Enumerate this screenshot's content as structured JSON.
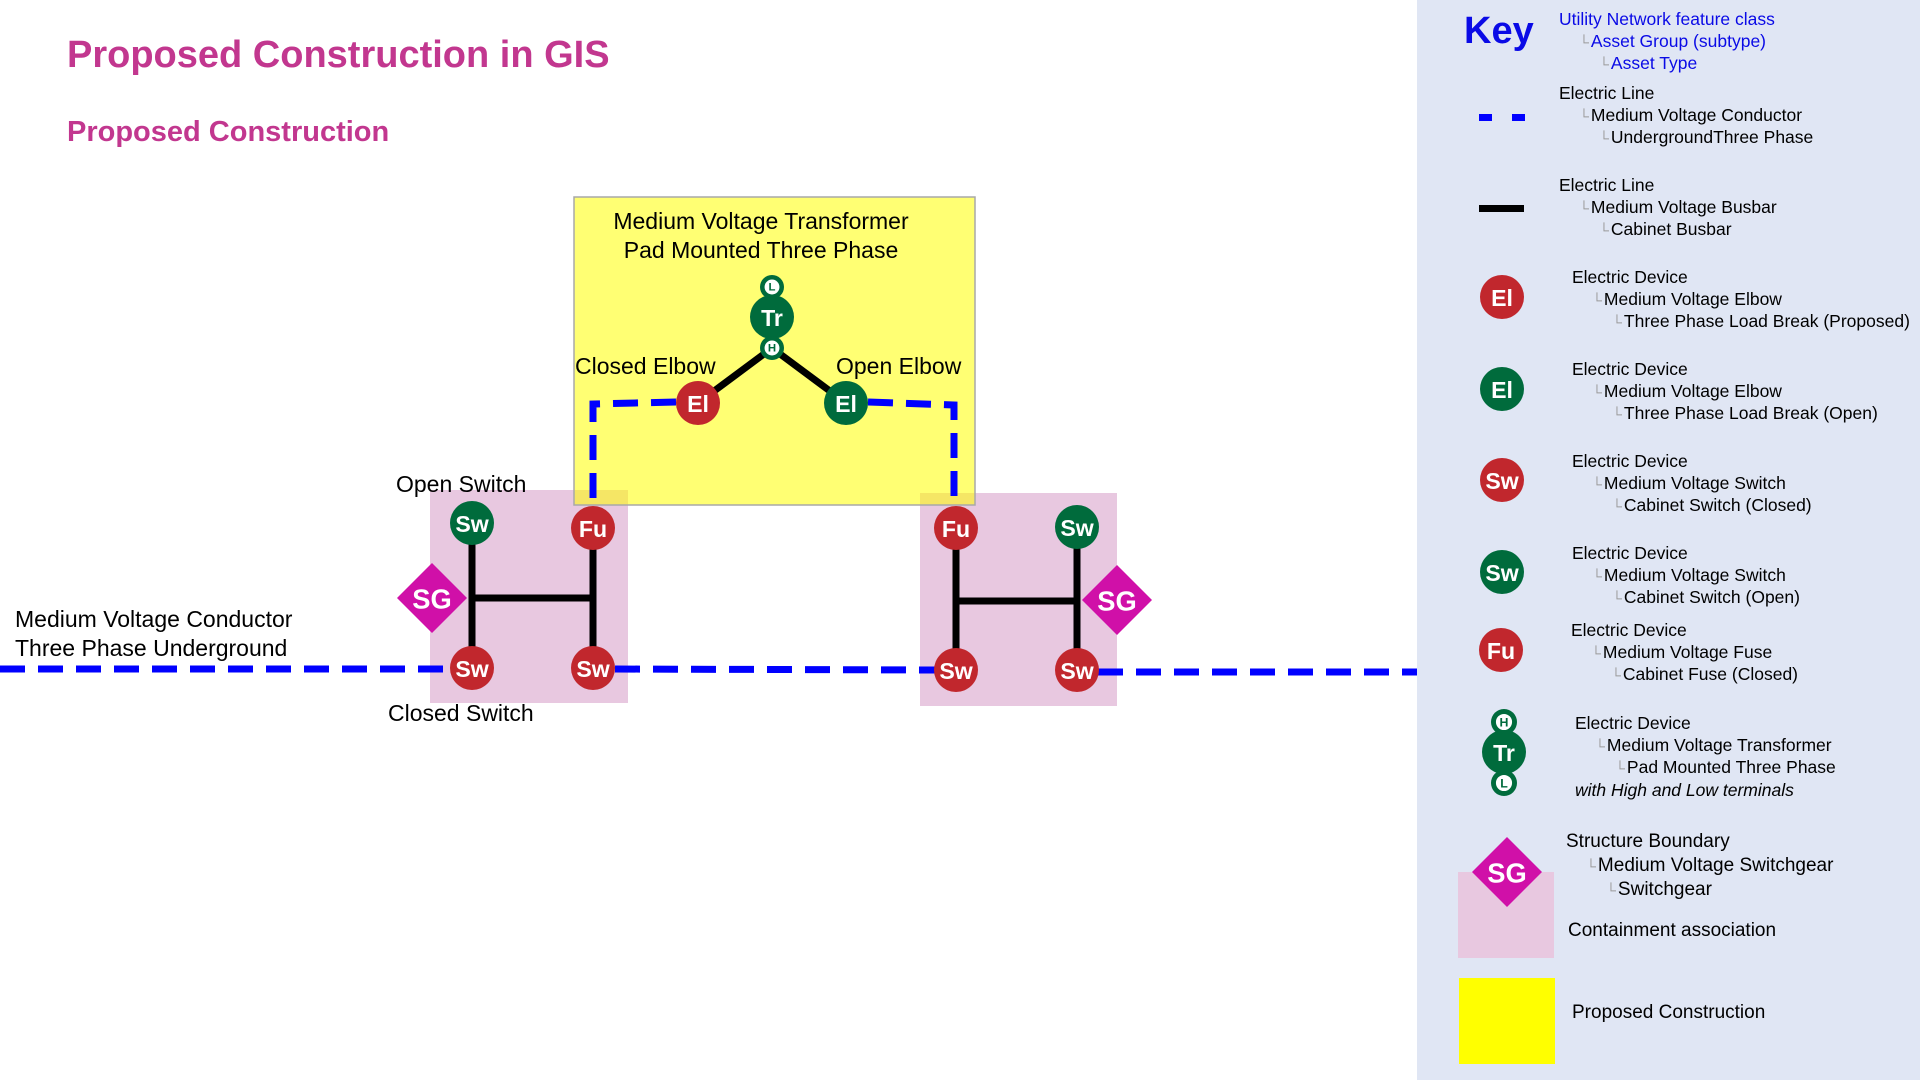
{
  "header": {
    "title": "Proposed Construction in GIS",
    "subtitle": "Proposed Construction"
  },
  "colors": {
    "title": "#c2378f",
    "conductor_blue": "#0000ff",
    "busbar_black": "#000000",
    "device_red": "#c1272d",
    "device_green": "#006b3c",
    "switchgear_magenta": "#d010a8",
    "containment_pink": "#e8c8e0",
    "proposed_yellow": "#ffff00",
    "key_background": "#e0e6f4",
    "key_heading_blue": "#0a0ae6"
  },
  "diagram": {
    "transformer_label_line1": "Medium Voltage Transformer",
    "transformer_label_line2": "Pad Mounted Three Phase",
    "closed_elbow_label": "Closed Elbow",
    "open_elbow_label": "Open Elbow",
    "open_switch_label": "Open Switch",
    "closed_switch_label": "Closed Switch",
    "conductor_label_line1": "Medium Voltage Conductor",
    "conductor_label_line2": "Three Phase Underground",
    "transformer": {
      "code": "Tr",
      "status": "green",
      "high_terminal": "H",
      "low_terminal": "L"
    },
    "elbows": [
      {
        "code": "El",
        "status": "red",
        "name": "closed-elbow"
      },
      {
        "code": "El",
        "status": "green",
        "name": "open-elbow"
      }
    ],
    "left_switchgear": {
      "code": "SG",
      "devices": [
        {
          "code": "Sw",
          "status": "green",
          "name": "open-switch"
        },
        {
          "code": "Fu",
          "status": "red",
          "name": "fuse"
        },
        {
          "code": "Sw",
          "status": "red",
          "name": "closed-switch-left"
        },
        {
          "code": "Sw",
          "status": "red",
          "name": "closed-switch-right"
        }
      ]
    },
    "right_switchgear": {
      "code": "SG",
      "devices": [
        {
          "code": "Fu",
          "status": "red",
          "name": "fuse"
        },
        {
          "code": "Sw",
          "status": "green",
          "name": "open-switch"
        },
        {
          "code": "Sw",
          "status": "red",
          "name": "closed-switch-left"
        },
        {
          "code": "Sw",
          "status": "red",
          "name": "closed-switch-right"
        }
      ]
    }
  },
  "key": {
    "title": "Key",
    "hierarchy": {
      "line1": "Utility Network feature class",
      "line2": "Asset Group (subtype)",
      "line3": "Asset Type"
    },
    "tick": "└",
    "entries": [
      {
        "symbol": "dashed-blue-line",
        "line1": "Electric Line",
        "line2": "Medium Voltage Conductor",
        "line3": "UndergroundThree Phase"
      },
      {
        "symbol": "black-busbar",
        "line1": "Electric Line",
        "line2": "Medium Voltage Busbar",
        "line3": "Cabinet Busbar"
      },
      {
        "symbol": "El",
        "status": "red",
        "line1": "Electric Device",
        "line2": "Medium Voltage Elbow",
        "line3": "Three Phase Load Break (Proposed)"
      },
      {
        "symbol": "El",
        "status": "green",
        "line1": "Electric Device",
        "line2": "Medium Voltage Elbow",
        "line3": "Three Phase Load Break (Open)"
      },
      {
        "symbol": "Sw",
        "status": "red",
        "line1": "Electric Device",
        "line2": "Medium Voltage Switch",
        "line3": "Cabinet Switch (Closed)"
      },
      {
        "symbol": "Sw",
        "status": "green",
        "line1": "Electric Device",
        "line2": "Medium Voltage Switch",
        "line3": "Cabinet Switch (Open)"
      },
      {
        "symbol": "Fu",
        "status": "red",
        "line1": "Electric Device",
        "line2": "Medium Voltage Fuse",
        "line3": "Cabinet Fuse (Closed)"
      },
      {
        "symbol": "Tr",
        "status": "green",
        "line1": "Electric Device",
        "line2": "Medium Voltage Transformer",
        "line3": "Pad Mounted Three Phase",
        "note": "with High and Low terminals",
        "high_terminal": "H",
        "low_terminal": "L"
      },
      {
        "symbol": "SG",
        "line1": "Structure Boundary",
        "line2": "Medium Voltage Switchgear",
        "line3": "Switchgear",
        "note": "Containment association"
      },
      {
        "symbol": "yellow-box",
        "label": "Proposed Construction"
      }
    ]
  }
}
